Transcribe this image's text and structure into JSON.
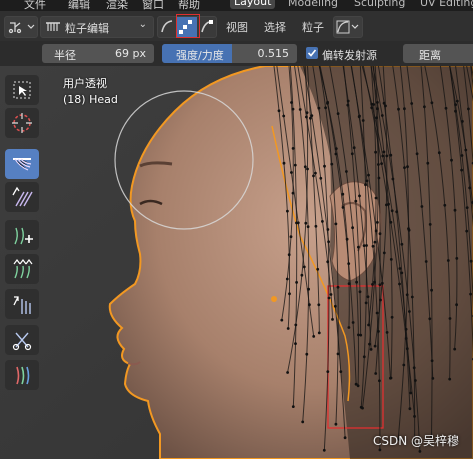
{
  "menu": {
    "items": [
      "文件",
      "编辑",
      "渲染",
      "窗口",
      "帮助"
    ],
    "workspaces": [
      "Layout",
      "Modeling",
      "Sculpting",
      "UV Editing"
    ],
    "active_workspace": "Layout"
  },
  "header": {
    "mode_label": "粒子编辑",
    "view_menu": "视图",
    "select_menu": "选择",
    "particle_menu": "粒子"
  },
  "tool_settings": {
    "radius_label": "半径",
    "radius_value": "69 px",
    "strength_label": "强度/力度",
    "strength_value": "0.515",
    "strength_fraction": 0.515,
    "deflect_label": "偏转发射源",
    "deflect_checked": true,
    "distance_label": "距离"
  },
  "viewport": {
    "view_name": "用户透视",
    "object_name": "(18) Head"
  },
  "toolbox": {
    "tools": [
      "select-box-icon",
      "cursor-icon",
      "comb-icon",
      "smooth-icon",
      "add-icon",
      "length-icon",
      "puff-icon",
      "cut-icon",
      "weight-icon"
    ],
    "active_tool": "comb-icon"
  },
  "colors": {
    "accent": "#4772b3",
    "outline": "#f29822",
    "annotation_red": "#e03030"
  },
  "watermark": "CSDN @吴梓穆"
}
